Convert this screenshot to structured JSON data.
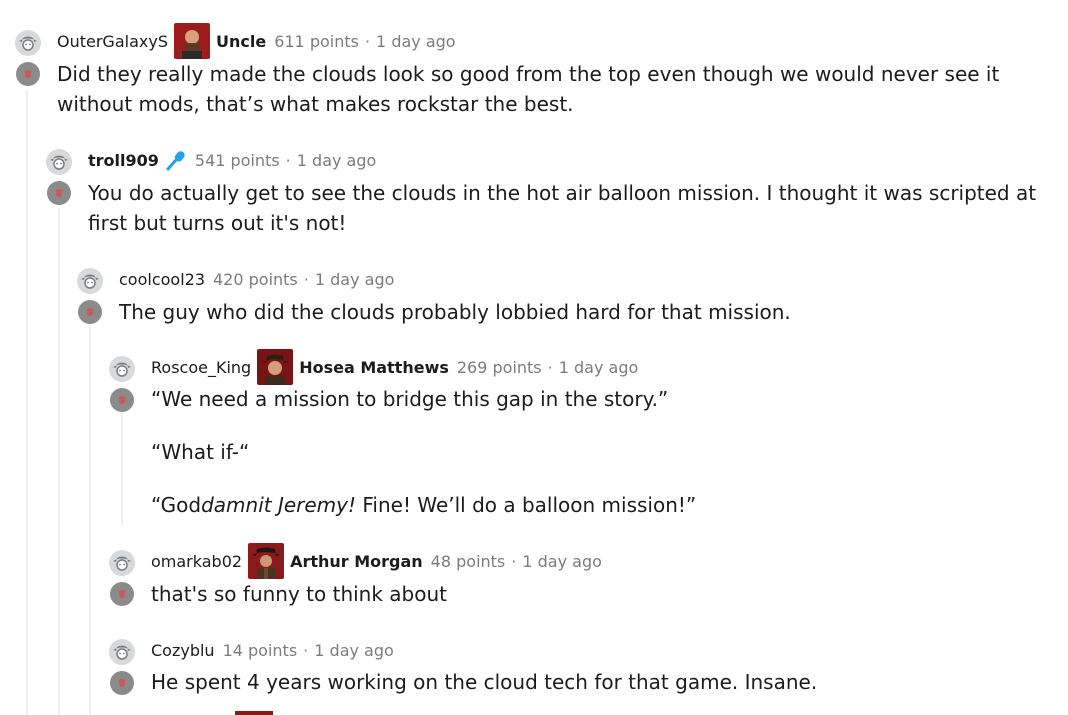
{
  "comments": [
    {
      "author": "OuterGalaxyS",
      "flair": "Uncle",
      "points": "611 points",
      "separator": "·",
      "time": "1 day ago",
      "body": [
        "Did they really made the clouds look so good from the top even though we would never see it",
        "without mods, that’s what makes rockstar the best."
      ]
    },
    {
      "author": "troll909",
      "points": "541 points",
      "separator": "·",
      "time": "1 day ago",
      "body": [
        "You do actually get to see the clouds in the hot air balloon mission. I thought it was scripted at",
        "first but turns out it's not!"
      ]
    },
    {
      "author": "coolcool23",
      "points": "420 points",
      "separator": "·",
      "time": "1 day ago",
      "body": [
        "The guy who did the clouds probably lobbied hard for that mission."
      ]
    },
    {
      "author": "Roscoe_King",
      "flair": "Hosea Matthews",
      "points": "269 points",
      "separator": "·",
      "time": "1 day ago",
      "body": [
        "“We need a mission to bridge this gap in the story.”",
        "“What if-“",
        "“God",
        "damnit Jeremy!",
        " Fine! We’ll do a balloon mission!”"
      ]
    },
    {
      "author": "omarkab02",
      "flair": "Arthur Morgan",
      "points": "48 points",
      "separator": "·",
      "time": "1 day ago",
      "body": [
        "that's so funny to think about"
      ]
    },
    {
      "author": "Cozyblu",
      "points": "14 points",
      "separator": "·",
      "time": "1 day ago",
      "body": [
        "He spent 4 years working on the cloud tech for that game. Insane."
      ]
    }
  ],
  "icons": {
    "avatar": "cowboy-avatar-icon",
    "collapse": "collapse-thread-icon",
    "mic": "microphone-icon"
  },
  "colors": {
    "meta_gray": "#7c7c7c",
    "thread_line": "#edeff1",
    "mic_blue": "#24a0ed",
    "flair_red": "#8b1a1a"
  }
}
